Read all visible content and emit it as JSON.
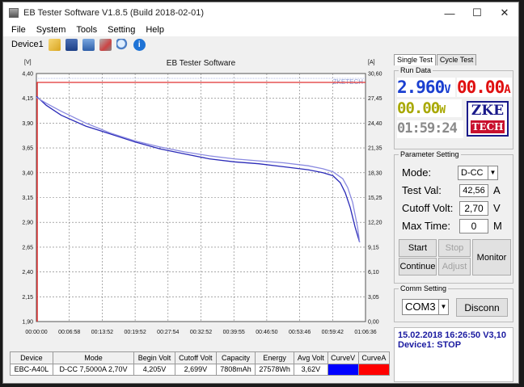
{
  "window": {
    "title": "EB Tester Software V1.8.5 (Build 2018-02-01)",
    "controls": [
      "—",
      "☐",
      "✕"
    ]
  },
  "menu": [
    "File",
    "System",
    "Tools",
    "Setting",
    "Help"
  ],
  "toolbar": {
    "device_label": "Device1",
    "icons": [
      "folder-icon",
      "save-icon",
      "monitor-icon",
      "tools-icon",
      "search-icon",
      "info-icon"
    ]
  },
  "chart_data": {
    "type": "line",
    "title": "EB Tester Software",
    "watermark": "ZKETECH",
    "left_unit": "[V]",
    "right_unit": "[A]",
    "ylim": [
      1.9,
      4.4
    ],
    "y_ticks": [
      "4,40",
      "4,15",
      "3,90",
      "3,65",
      "3,40",
      "3,15",
      "2,90",
      "2,65",
      "2,40",
      "2,15",
      "1,90"
    ],
    "y2_ticks": [
      "30,60",
      "27,45",
      "24,40",
      "21,35",
      "18,30",
      "15,25",
      "12,20",
      "9,15",
      "6,10",
      "3,05",
      "0,00"
    ],
    "x_ticks": [
      "00:00:00",
      "00:06:58",
      "00:13:52",
      "00:19:52",
      "00:27:54",
      "00:32:52",
      "00:39:55",
      "00:46:50",
      "00:53:46",
      "00:59:42",
      "01:06:36"
    ],
    "xlim_minutes": [
      0,
      66.6
    ],
    "cutoff_voltage": 2.7,
    "current_level": 29.5,
    "series": [
      {
        "color": "#2a2ab8",
        "x": [
          0,
          2,
          5,
          10,
          15,
          20,
          25,
          30,
          35,
          40,
          45,
          50,
          55,
          58,
          60,
          61.5,
          62.5,
          63.5,
          64.5,
          65.4
        ],
        "y": [
          4.17,
          4.08,
          3.98,
          3.87,
          3.79,
          3.71,
          3.64,
          3.59,
          3.54,
          3.51,
          3.49,
          3.46,
          3.43,
          3.4,
          3.37,
          3.3,
          3.2,
          3.05,
          2.85,
          2.7
        ]
      },
      {
        "color": "#8a8ae0",
        "x": [
          0,
          2,
          5,
          10,
          15,
          20,
          25,
          30,
          35,
          40,
          45,
          50,
          55,
          58,
          60,
          62,
          63,
          64,
          65,
          65.4
        ],
        "y": [
          4.16,
          4.1,
          4.02,
          3.9,
          3.8,
          3.72,
          3.66,
          3.61,
          3.57,
          3.54,
          3.52,
          3.5,
          3.47,
          3.44,
          3.41,
          3.34,
          3.25,
          3.1,
          2.85,
          2.7
        ]
      }
    ]
  },
  "table": {
    "headers": [
      "Device",
      "Mode",
      "Begin Volt",
      "Cutoff Volt",
      "Capacity",
      "Energy",
      "Avg Volt",
      "CurveV",
      "CurveA"
    ],
    "row": {
      "device": "EBC-A40L",
      "mode": "D-CC 7,5000A 2,70V",
      "begin_volt": "4,205V",
      "cutoff_volt": "2,699V",
      "capacity": "7808mAh",
      "energy": "27578Wh",
      "avg_volt": "3,62V",
      "curve_v_color": "#0000ff",
      "curve_a_color": "#ff0000"
    }
  },
  "panel": {
    "tabs": [
      "Single Test",
      "Cycle Test"
    ],
    "run_data_title": "Run Data",
    "voltage": "2.960",
    "voltage_unit": "V",
    "current": "00.00",
    "current_unit": "A",
    "power": "00.00",
    "power_unit": "W",
    "time": "01:59:24",
    "logo_top": "ZKE",
    "logo_bottom": "TECH",
    "param_title": "Parameter Setting",
    "mode_label": "Mode:",
    "mode_value": "D-CC",
    "test_val_label": "Test Val:",
    "test_val": "42,56",
    "test_val_unit": "A",
    "cutoff_label": "Cutoff Volt:",
    "cutoff_value": "2,70",
    "cutoff_unit": "V",
    "max_time_label": "Max Time:",
    "max_time_value": "0",
    "max_time_unit": "M",
    "start": "Start",
    "stop": "Stop",
    "continue": "Continue",
    "adjust": "Adjust",
    "monitor": "Monitor",
    "comm_title": "Comm Setting",
    "com_port": "COM3",
    "disconnect": "Disconn",
    "status_line1": "15.02.2018 16:26:50  V3,10",
    "status_line2": "Device1: STOP"
  }
}
